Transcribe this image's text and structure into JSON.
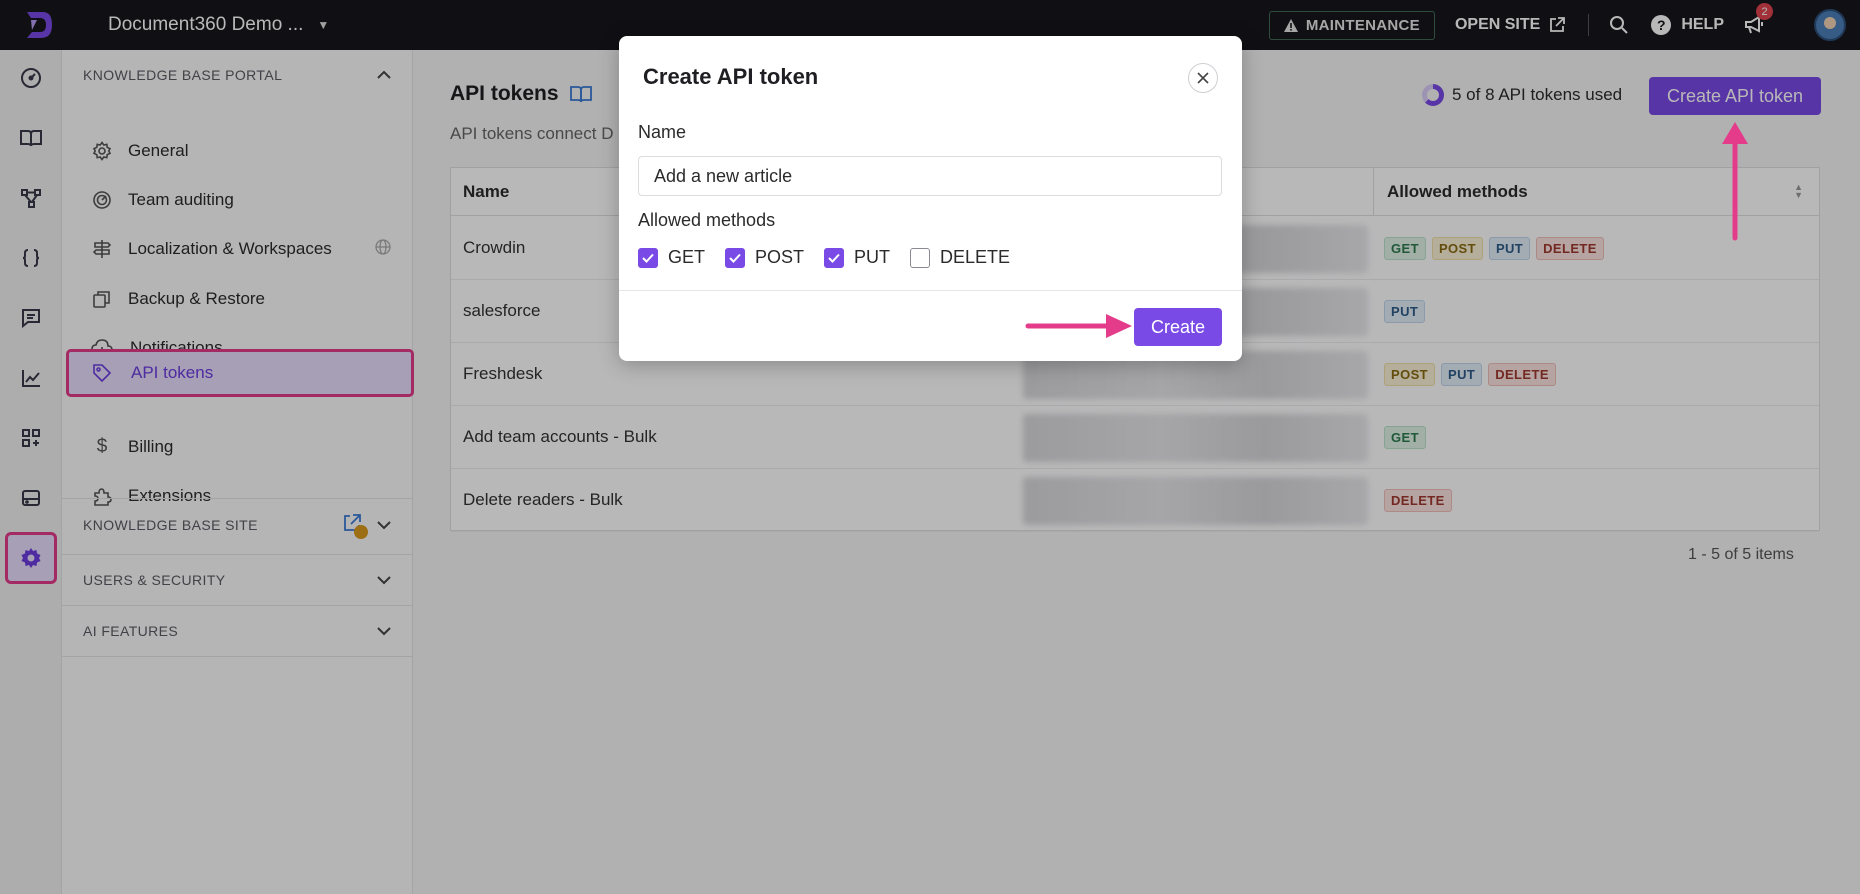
{
  "topbar": {
    "project_name": "Document360 Demo ...",
    "maintenance_label": "MAINTENANCE",
    "open_site_label": "OPEN SITE",
    "help_label": "HELP",
    "notification_count": "2"
  },
  "nav": {
    "kb_portal_title": "KNOWLEDGE BASE PORTAL",
    "items": [
      {
        "label": "General"
      },
      {
        "label": "Team auditing"
      },
      {
        "label": "Localization & Workspaces"
      },
      {
        "label": "Backup & Restore"
      },
      {
        "label": "Notifications"
      },
      {
        "label": "API tokens"
      },
      {
        "label": "Billing"
      },
      {
        "label": "Extensions"
      }
    ],
    "kb_site_title": "KNOWLEDGE BASE SITE",
    "users_security_title": "USERS & SECURITY",
    "ai_features_title": "AI FEATURES"
  },
  "main": {
    "title": "API tokens",
    "description": "API tokens connect D",
    "usage_text": "5 of 8 API tokens used",
    "usage_fraction": 0.625,
    "create_button": "Create API token",
    "table": {
      "col_name": "Name",
      "col_methods": "Allowed methods",
      "rows": [
        {
          "name": "Crowdin",
          "methods": [
            "GET",
            "POST",
            "PUT",
            "DELETE"
          ]
        },
        {
          "name": "salesforce",
          "methods": [
            "PUT"
          ]
        },
        {
          "name": "Freshdesk",
          "methods": [
            "POST",
            "PUT",
            "DELETE"
          ]
        },
        {
          "name": "Add team accounts - Bulk",
          "methods": [
            "GET"
          ]
        },
        {
          "name": "Delete readers - Bulk",
          "methods": [
            "DELETE"
          ]
        }
      ]
    },
    "pagination": "1 - 5 of 5 items"
  },
  "modal": {
    "title": "Create API token",
    "name_label": "Name",
    "name_value": "Add a new article",
    "methods_label": "Allowed methods",
    "methods": [
      {
        "label": "GET",
        "checked": true
      },
      {
        "label": "POST",
        "checked": true
      },
      {
        "label": "PUT",
        "checked": true
      },
      {
        "label": "DELETE",
        "checked": false
      }
    ],
    "create_button": "Create"
  },
  "colors": {
    "accent": "#7a4ae6",
    "highlight": "#e43b8a",
    "topbar": "#17171c"
  }
}
